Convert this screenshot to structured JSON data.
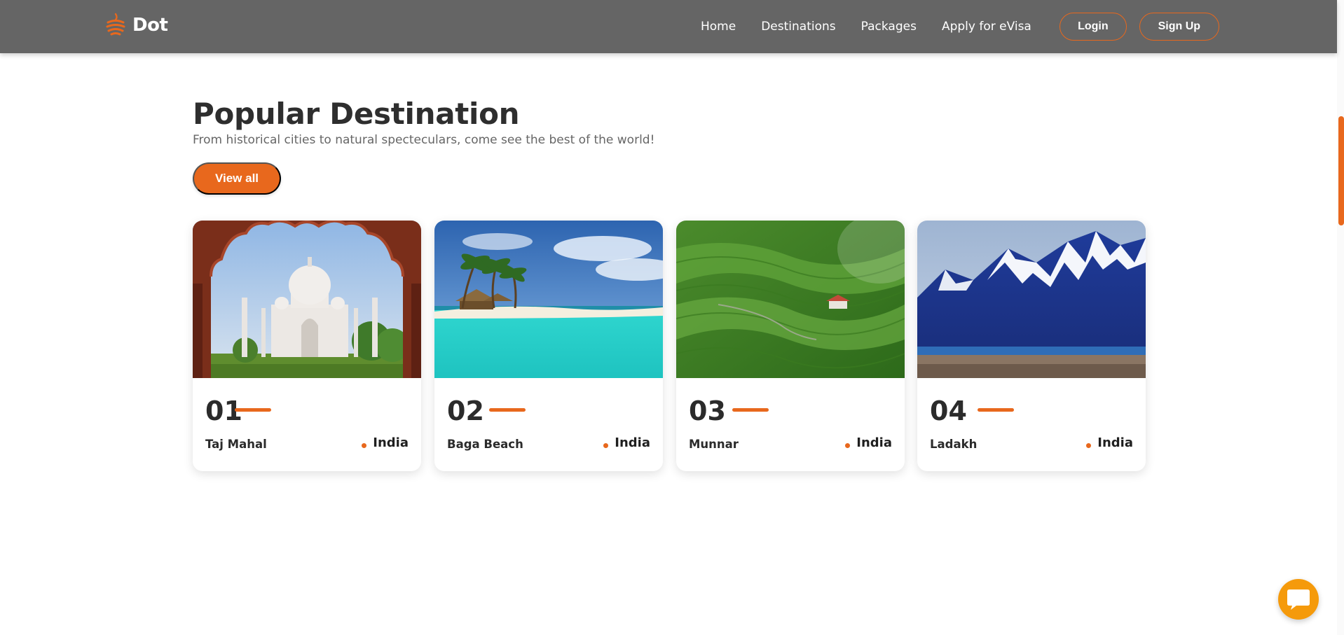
{
  "brand": {
    "name": "Dot",
    "icon": "globe-logo-icon",
    "accent_color": "#e8681d"
  },
  "nav": {
    "links": [
      "Home",
      "Destinations",
      "Packages",
      "Apply for eVisa"
    ],
    "login_label": "Login",
    "signup_label": "Sign Up"
  },
  "section": {
    "title": "Popular Destination",
    "subtitle": "From historical cities to natural specteculars, come see the best of the world!",
    "view_all_label": "View all"
  },
  "cards": [
    {
      "number": "01",
      "name": "Taj Mahal",
      "country": "India",
      "image": "taj-mahal-photo"
    },
    {
      "number": "02",
      "name": "Baga Beach",
      "country": "India",
      "image": "beach-photo"
    },
    {
      "number": "03",
      "name": "Munnar",
      "country": "India",
      "image": "tea-plantation-photo"
    },
    {
      "number": "04",
      "name": "Ladakh",
      "country": "India",
      "image": "mountains-lake-photo"
    }
  ],
  "chat": {
    "icon": "chat-bubble-icon",
    "color": "#f59a0b"
  }
}
